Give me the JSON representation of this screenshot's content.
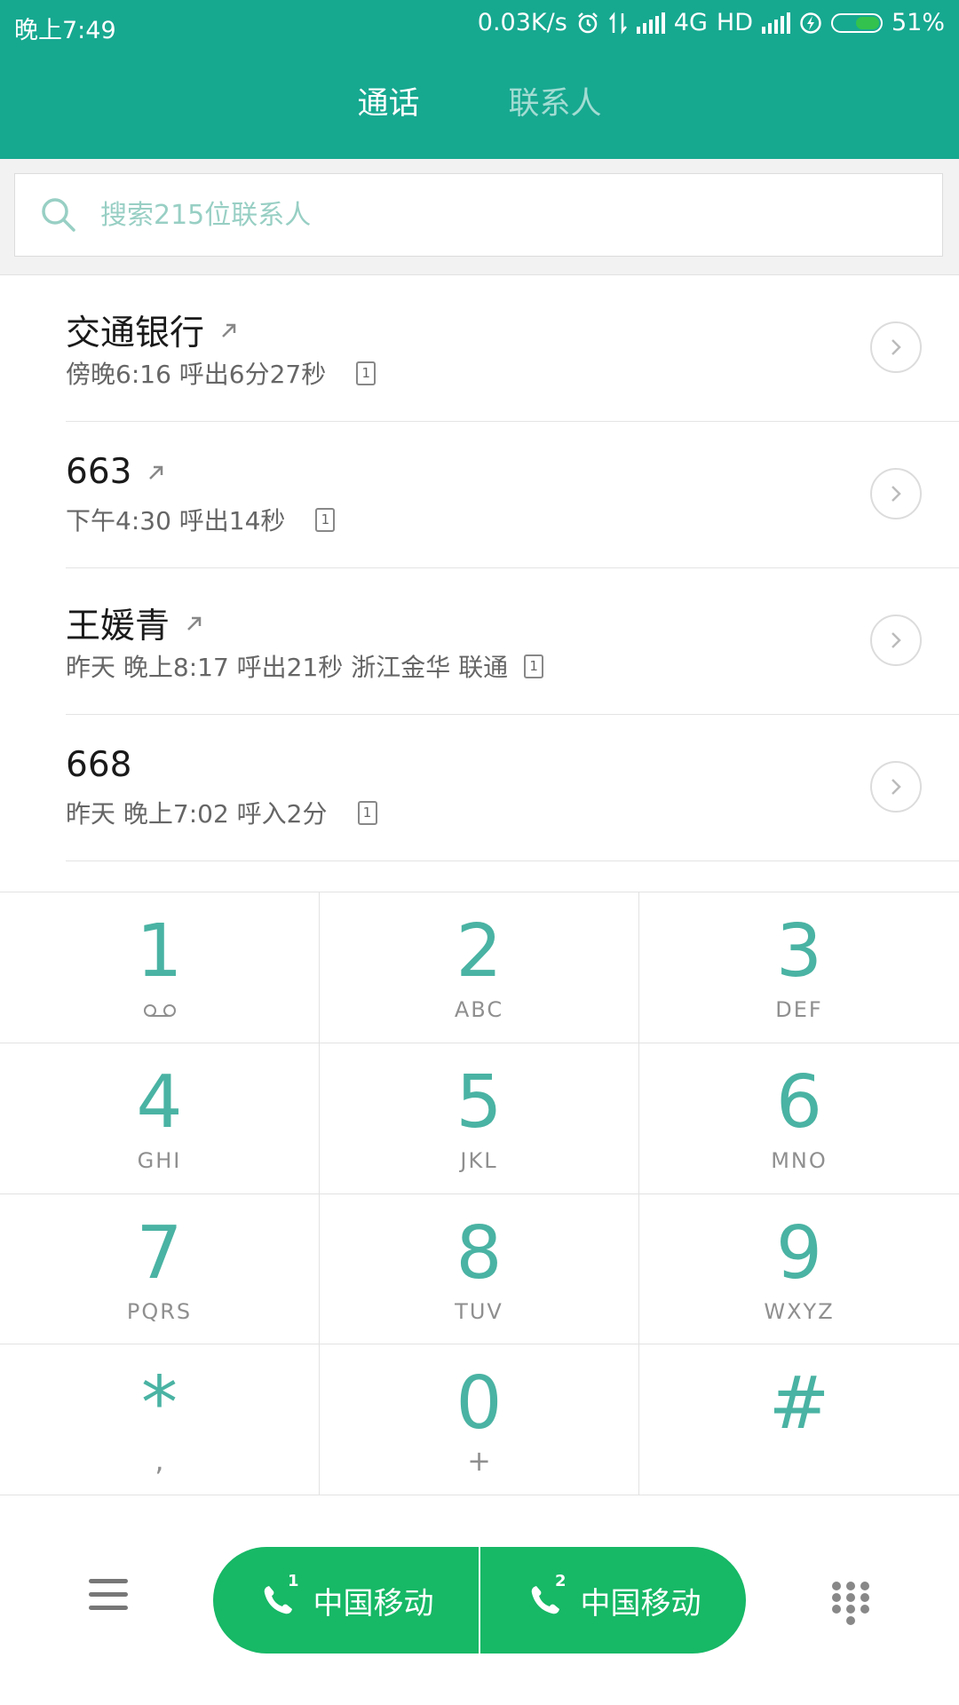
{
  "status_bar": {
    "time": "晚上7:49",
    "net_speed": "0.03K/s",
    "network": "4G",
    "hd": "HD",
    "battery": "51%",
    "battery_level": 0.51
  },
  "tabs": [
    {
      "label": "通话",
      "active": true
    },
    {
      "label": "联系人",
      "active": false
    }
  ],
  "search": {
    "placeholder": "搜索215位联系人",
    "value": ""
  },
  "calls": [
    {
      "name": "交通银行",
      "outgoing": true,
      "detail": "傍晚6:16 呼出6分27秒",
      "sim": "1"
    },
    {
      "name": "663",
      "outgoing": true,
      "detail": "下午4:30 呼出14秒",
      "sim": "1"
    },
    {
      "name": "王媛青",
      "outgoing": true,
      "detail": "昨天 晚上8:17 呼出21秒  浙江金华 联通",
      "sim": "1"
    },
    {
      "name": "668",
      "outgoing": false,
      "detail": "昨天 晚上7:02 呼入2分",
      "sim": "1"
    }
  ],
  "dialpad": [
    {
      "digit": "1",
      "letters": "",
      "sub": "",
      "voicemail": true
    },
    {
      "digit": "2",
      "letters": "ABC"
    },
    {
      "digit": "3",
      "letters": "DEF"
    },
    {
      "digit": "4",
      "letters": "GHI"
    },
    {
      "digit": "5",
      "letters": "JKL"
    },
    {
      "digit": "6",
      "letters": "MNO"
    },
    {
      "digit": "7",
      "letters": "PQRS"
    },
    {
      "digit": "8",
      "letters": "TUV"
    },
    {
      "digit": "9",
      "letters": "WXYZ"
    },
    {
      "digit": "*",
      "letters": "",
      "sub": ","
    },
    {
      "digit": "0",
      "letters": "",
      "sub": "+"
    },
    {
      "digit": "#",
      "letters": "",
      "sub": ""
    }
  ],
  "call_buttons": [
    {
      "sim": "1",
      "label": "中国移动"
    },
    {
      "sim": "2",
      "label": "中国移动"
    }
  ],
  "colors": {
    "header": "#17a890",
    "accent": "#4ab3a3",
    "call_button": "#17b866"
  },
  "icons": {
    "menu": "hamburger-icon",
    "dialpad_toggle": "dialpad-grid-icon",
    "search": "search-icon",
    "detail": "chevron-right-icon"
  }
}
